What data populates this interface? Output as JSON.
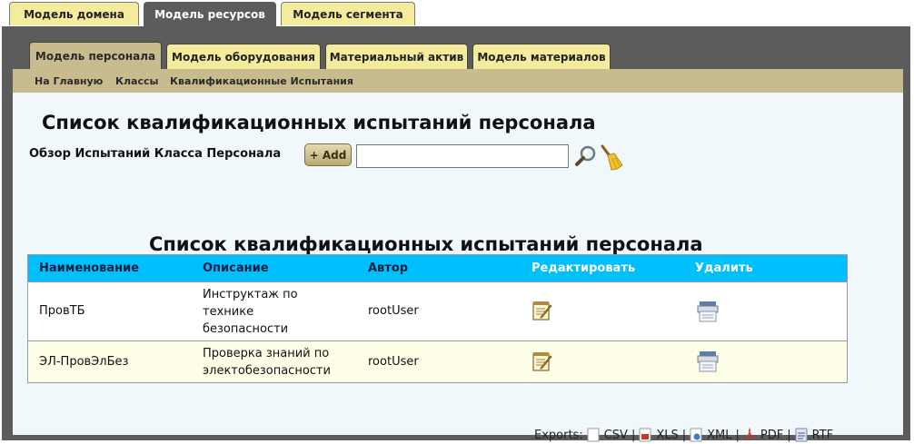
{
  "top_tabs": [
    "Модель домена",
    "Модель ресурсов",
    "Модель сегмента"
  ],
  "sub_tabs": [
    "Модель персонала",
    "Модель оборудования",
    "Материальный актив",
    "Модель материалов"
  ],
  "breadcrumb": {
    "home": "На Главную",
    "classes": "Классы",
    "current": "Квалификационные Испытания"
  },
  "page": {
    "title": "Список квалификационных испытаний персонала",
    "filter_label": "Обзор Испытаний Класса Персонала",
    "add_label": "+ Add",
    "search_value": "",
    "table_title": "Список квалификационных испытаний персонала"
  },
  "table": {
    "headers": [
      "Наименование",
      "Описание",
      "Автор",
      "Редактировать",
      "Удалить"
    ],
    "rows": [
      {
        "name": "ПровТБ",
        "description": [
          "Инструктаж по",
          "технике",
          "безопасности"
        ],
        "author": "rootUser"
      },
      {
        "name": "ЭЛ-ПровЭлБез",
        "description": [
          "Проверка знаний по",
          "электобезопасности"
        ],
        "author": "rootUser"
      }
    ]
  },
  "exports": {
    "label": "Exports:",
    "items": [
      "CSV",
      "XLS",
      "XML",
      "PDF",
      "RTF"
    ],
    "separator": "|"
  },
  "colors": {
    "panel": "#5c5c5c",
    "tab": "#f4ec9c",
    "crumb": "#c8bc8e",
    "header": "#00bfff",
    "alt_row": "#fffee6"
  }
}
